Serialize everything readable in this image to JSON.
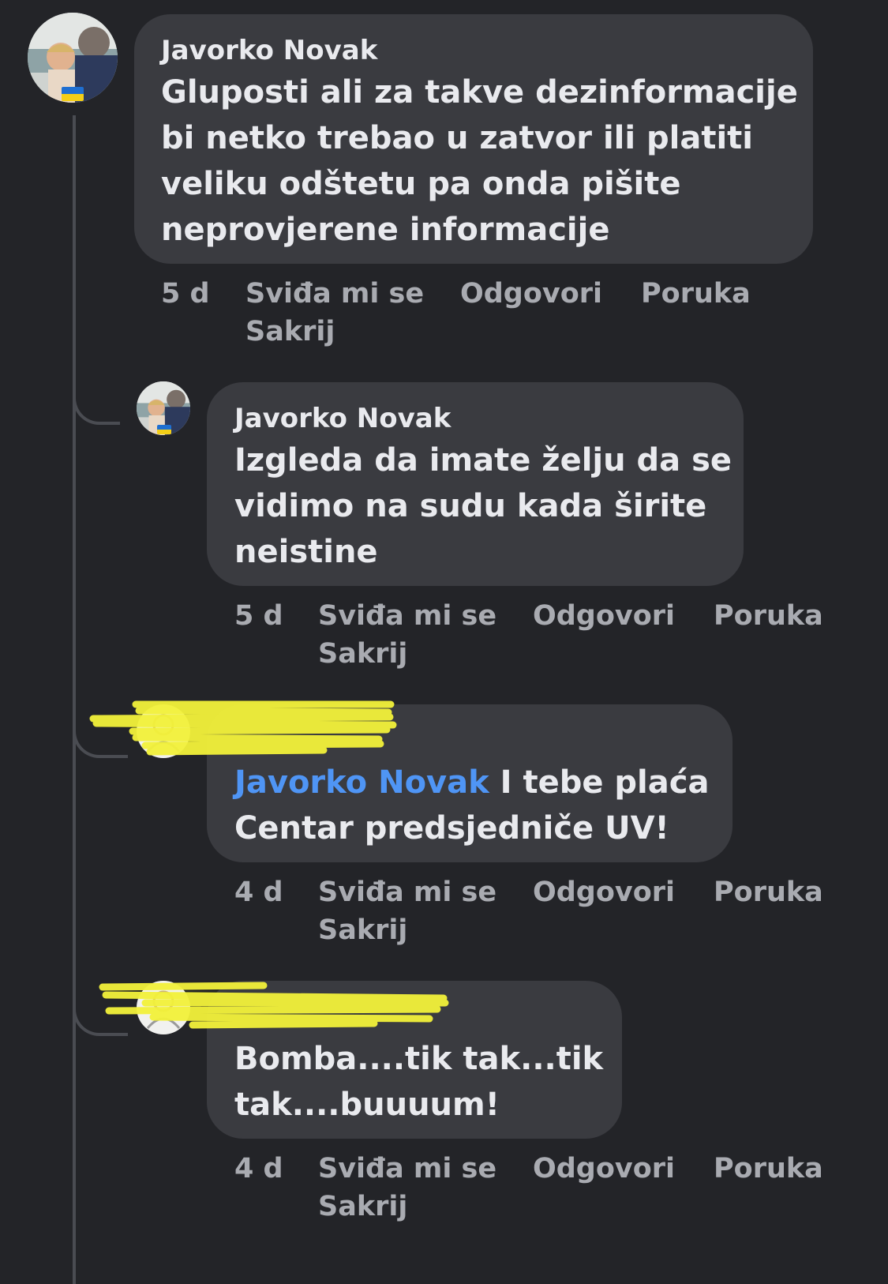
{
  "comments": [
    {
      "author": "Javorko Novak",
      "lines": [
        "Gluposti ali za takve dezinformacije",
        "bi netko trebao u zatvor ili platiti",
        "veliku odštetu pa onda pišite",
        "neprovjerene informacije"
      ],
      "time": "5 d",
      "like": "Sviđa mi se",
      "reply": "Odgovori",
      "message": "Poruka",
      "hide": "Sakrij"
    },
    {
      "author": "Javorko Novak",
      "lines": [
        "Izgleda da imate želju da se",
        "vidimo na sudu kada širite",
        "neistine"
      ],
      "time": "5 d",
      "like": "Sviđa mi se",
      "reply": "Odgovori",
      "message": "Poruka",
      "hide": "Sakrij"
    },
    {
      "author_redacted": true,
      "mention": "Javorko Novak",
      "line1_rest": " I tebe plaća",
      "line2": "Centar predsjedniče UV!",
      "time": "4 d",
      "like": "Sviđa mi se",
      "reply": "Odgovori",
      "message": "Poruka",
      "hide": "Sakrij"
    },
    {
      "author_redacted": true,
      "lines": [
        "Bomba....tik tak...tik",
        "tak....buuuum!"
      ],
      "time": "4 d",
      "like": "Sviđa mi se",
      "reply": "Odgovori",
      "message": "Poruka",
      "hide": "Sakrij"
    }
  ],
  "colors": {
    "background": "#232428",
    "bubble": "#3a3b40",
    "mention": "#4f95f5",
    "redaction": "#f3f23a",
    "flag_blue": "#1f6fd1",
    "flag_yellow": "#f4cf17"
  }
}
